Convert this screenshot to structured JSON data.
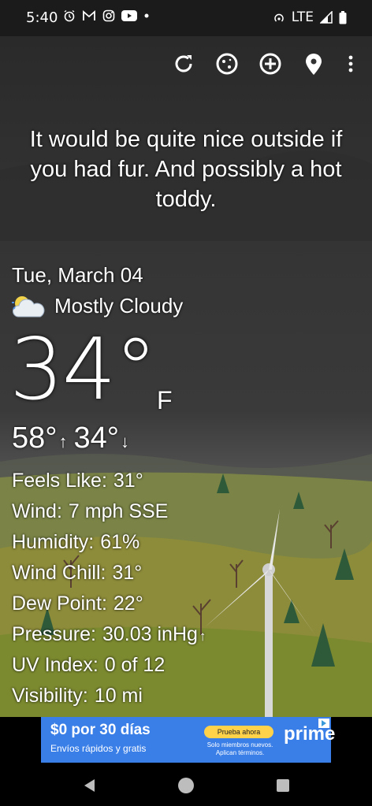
{
  "status_bar": {
    "time": "5:40",
    "network": "LTE",
    "icons": [
      "alarm-icon",
      "gmail-icon",
      "instagram-icon",
      "youtube-icon",
      "dot-icon",
      "hotspot-icon",
      "signal-icon",
      "battery-icon"
    ]
  },
  "toolbar": {
    "actions": [
      "refresh-icon",
      "moon-phase-icon",
      "add-location-icon",
      "location-pin-icon",
      "more-vert-icon"
    ]
  },
  "quote": "It would be quite nice outside if you had fur. And possibly a hot toddy.",
  "weather": {
    "date": "Tue, March 04",
    "condition": "Mostly Cloudy",
    "temperature": "34°",
    "unit": "F",
    "high": "58°",
    "high_arrow": "↑",
    "low": "34°",
    "low_arrow": "↓"
  },
  "details": [
    {
      "label": "Feels Like:",
      "value": "31°"
    },
    {
      "label": "Wind:",
      "value": "7 mph SSE"
    },
    {
      "label": "Humidity:",
      "value": "61%"
    },
    {
      "label": "Wind Chill:",
      "value": "31°"
    },
    {
      "label": "Dew Point:",
      "value": "22°"
    },
    {
      "label": "Pressure:",
      "value": "30.03 inHg",
      "trend": "↑"
    },
    {
      "label": "UV Index:",
      "value": "0 of 12"
    },
    {
      "label": "Visibility:",
      "value": "10 mi"
    }
  ],
  "ad": {
    "title": "$0 por 30 días",
    "subtitle": "Envíos rápidos y gratis",
    "cta": "Prueba ahora",
    "members": "Solo miembros nuevos. Aplican términos.",
    "brand": "prime",
    "brand_color": "#3a7fe8"
  },
  "nav": [
    "back-icon",
    "home-icon",
    "recents-icon"
  ]
}
